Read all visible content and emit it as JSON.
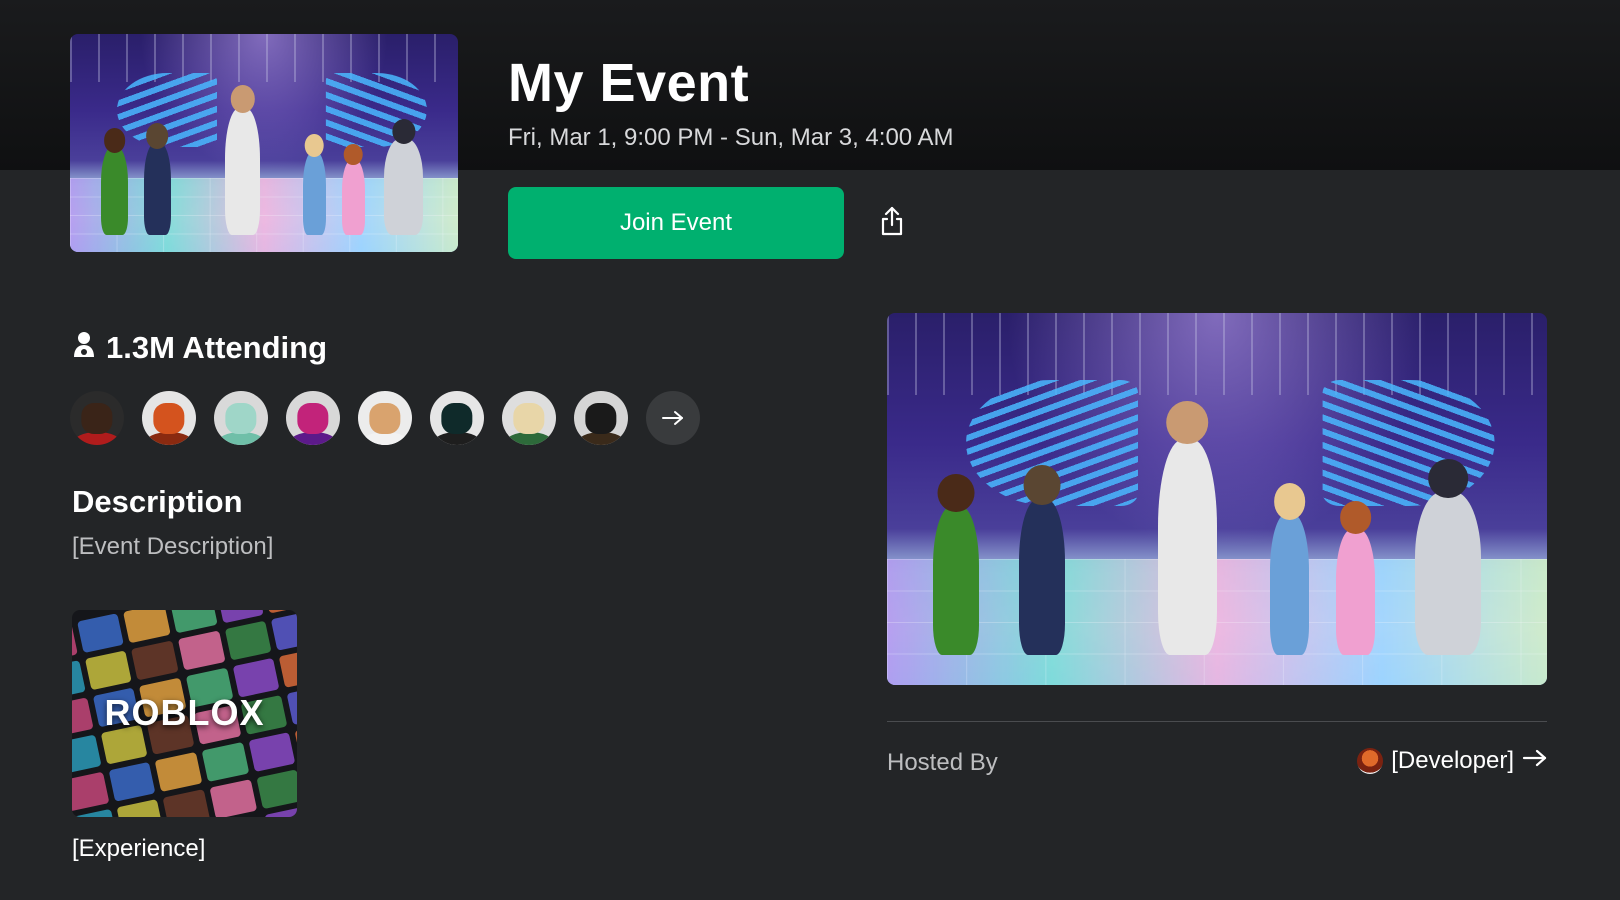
{
  "event": {
    "title": "My Event",
    "dates": "Fri, Mar 1, 9:00 PM - Sun, Mar 3, 4:00 AM",
    "join_label": "Join Event"
  },
  "attendance": {
    "count_label": "1.3M Attending",
    "avatars": [
      {
        "name": "avatar-1",
        "bg": "#2b2b2b",
        "face": "#3a2418",
        "body": "#b01c1c"
      },
      {
        "name": "avatar-2",
        "bg": "#e5e5e5",
        "face": "#d4531e",
        "body": "#8a2a10"
      },
      {
        "name": "avatar-3",
        "bg": "#d9d9d9",
        "face": "#9fd6c8",
        "body": "#6fbfa8"
      },
      {
        "name": "avatar-4",
        "bg": "#d8d8d8",
        "face": "#c2237a",
        "body": "#5c1a8a"
      },
      {
        "name": "avatar-5",
        "bg": "#ececec",
        "face": "#d9a36e",
        "body": "#f2f2f2"
      },
      {
        "name": "avatar-6",
        "bg": "#e6e6e6",
        "face": "#0f2a2a",
        "body": "#1e1e1e"
      },
      {
        "name": "avatar-7",
        "bg": "#dedede",
        "face": "#e8d6a8",
        "body": "#2d6a3a"
      },
      {
        "name": "avatar-8",
        "bg": "#d5d5d5",
        "face": "#1a1a1a",
        "body": "#3a2a1a"
      }
    ]
  },
  "description": {
    "heading": "Description",
    "text": "[Event Description]"
  },
  "experience": {
    "logo_text": "ROBLOX",
    "name": "[Experience]"
  },
  "host": {
    "label": "Hosted By",
    "developer": "[Developer]"
  },
  "colors": {
    "background": "#232527",
    "accent_green": "#00b06f"
  },
  "icons": [
    "person-icon",
    "share-icon",
    "arrow-right-icon"
  ]
}
